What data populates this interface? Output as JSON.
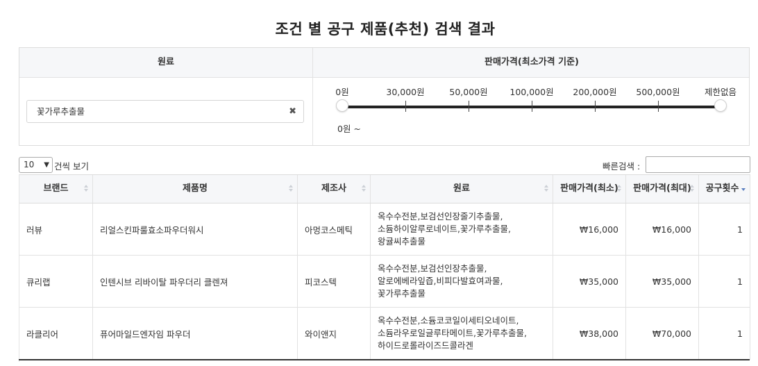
{
  "title": "조건 별 공구 제품(추천) 검색 결과",
  "filter": {
    "material_header": "원료",
    "price_header": "판매가격(최소가격 기준)",
    "material_value": "꽃가루추출물",
    "clear_glyph": "✖",
    "price_ticks": [
      "0원",
      "30,000원",
      "50,000원",
      "100,000원",
      "200,000원",
      "500,000원",
      "제한없음"
    ],
    "range_readout": "0원 ~"
  },
  "controls": {
    "length_value": "10",
    "length_label": "건씩 보기",
    "search_label": "빠른검색 :"
  },
  "table": {
    "headers": [
      "브랜드",
      "제품명",
      "제조사",
      "원료",
      "판매가격(최소)",
      "판매가격(최대)",
      "공구횟수"
    ],
    "rows": [
      {
        "brand": "러뷰",
        "product": "리얼스킨파룰효소파우더워시",
        "maker": "아멍코스메틱",
        "material": [
          "옥수수전분,보검선인장줄기추출물,",
          "소듐하이알루로네이트,꽃가루추출물,",
          "왕귤씨추출물"
        ],
        "price_min": "₩16,000",
        "price_max": "₩16,000",
        "count": "1"
      },
      {
        "brand": "큐리랩",
        "product": "인텐시브 리바이탈 파우더리 클렌져",
        "maker": "피코스텍",
        "material": [
          "옥수수전분,보검선인장추출물,",
          "알로에베라잎즙,비피다발효여과물,",
          "꽃가루추출물"
        ],
        "price_min": "₩35,000",
        "price_max": "₩35,000",
        "count": "1"
      },
      {
        "brand": "라클리어",
        "product": "퓨어마일드엔자임 파우더",
        "maker": "와이앤지",
        "material": [
          "옥수수전분,소듐코코일이세티오네이트,",
          "소듐라우로일글루타메이트,꽃가루추출물,",
          "하이드로롤라이즈드콜라겐"
        ],
        "price_min": "₩38,000",
        "price_max": "₩70,000",
        "count": "1"
      }
    ]
  }
}
